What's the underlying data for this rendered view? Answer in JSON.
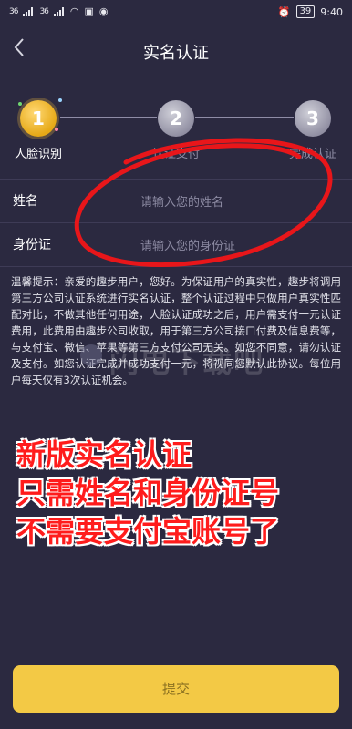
{
  "status_bar": {
    "sim1": "36",
    "sim2": "36",
    "time": "9:40",
    "battery": "39"
  },
  "header": {
    "back_icon": "chevron-left-icon",
    "title": "实名认证"
  },
  "steps": [
    {
      "number": "1",
      "label": "人脸识别",
      "state": "active"
    },
    {
      "number": "2",
      "label": "认证支付",
      "state": "inactive"
    },
    {
      "number": "3",
      "label": "完成认证",
      "state": "inactive"
    }
  ],
  "form": {
    "name_label": "姓名",
    "name_placeholder": "请输入您的姓名",
    "id_label": "身份证",
    "id_placeholder": "请输入您的身份证"
  },
  "notice": "温馨提示：亲爱的趣步用户，您好。为保证用户的真实性，趣步将调用第三方公司认证系统进行实名认证，整个认证过程中只做用户真实性匹配对比，不做其他任何用途，人脸认证成功之后，用户需支付一元认证费用，此费用由趣步公司收取，用于第三方公司接口付费及信息费等，与支付宝、微信、苹果等第三方支付公司无关。如您不同意，请勿认证及支付。如您认证完成并成功支付一元，将视同您默认此协议。每位用户每天仅有3次认证机会。",
  "watermark": "闪电下载吧",
  "overlay_text": [
    "新版实名认证",
    "只需姓名和身份证号",
    "不需要支付宝账号了"
  ],
  "submit_label": "提交",
  "colors": {
    "background": "#2b2940",
    "accent": "#f3c945",
    "overlay_red": "#ff1c1c"
  }
}
